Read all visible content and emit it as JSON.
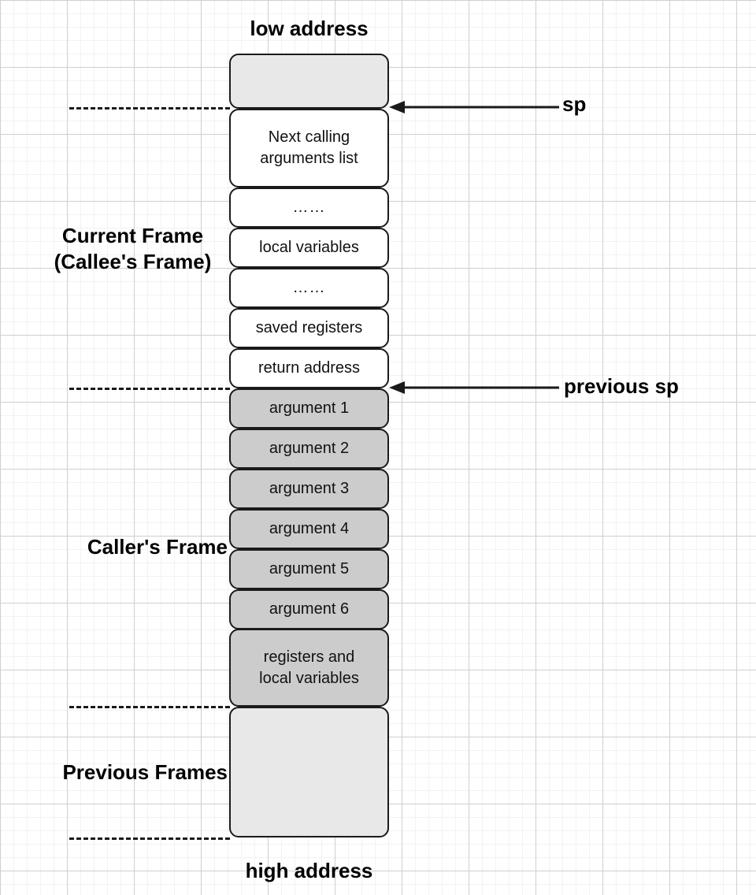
{
  "diagram": {
    "title_top": "low address",
    "title_bottom": "high address",
    "frames": {
      "current": "Current Frame\n(Callee's Frame)",
      "caller": "Caller's Frame",
      "previous": "Previous Frames"
    },
    "pointers": {
      "sp": "sp",
      "previous_sp": "previous sp"
    },
    "cells": [
      {
        "label": "",
        "style": "empty-top"
      },
      {
        "label": "Next calling\narguments list",
        "style": "white"
      },
      {
        "label": "……",
        "style": "white"
      },
      {
        "label": "local variables",
        "style": "white"
      },
      {
        "label": "……",
        "style": "white"
      },
      {
        "label": "saved registers",
        "style": "white"
      },
      {
        "label": "return address",
        "style": "white"
      },
      {
        "label": "argument 1",
        "style": "shaded"
      },
      {
        "label": "argument 2",
        "style": "shaded"
      },
      {
        "label": "argument 3",
        "style": "shaded"
      },
      {
        "label": "argument 4",
        "style": "shaded"
      },
      {
        "label": "argument 5",
        "style": "shaded"
      },
      {
        "label": "argument 6",
        "style": "shaded"
      },
      {
        "label": "registers and\nlocal variables",
        "style": "shaded"
      },
      {
        "label": "",
        "style": "empty-bottom"
      }
    ],
    "colors": {
      "stroke": "#1a1a1a",
      "empty_fill": "#e8e8e8",
      "shaded_fill": "#cccccc",
      "white_fill": "#ffffff",
      "grid_minor": "#f2f2f2",
      "grid_major": "#cfcfcf"
    }
  }
}
